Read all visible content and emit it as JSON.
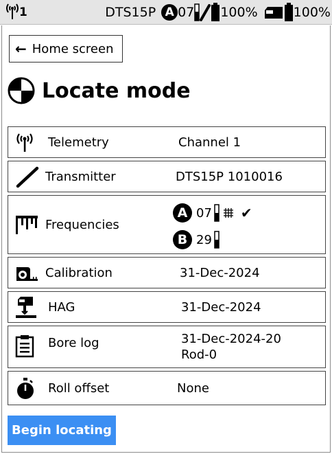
{
  "status_bar": {
    "channel": "1",
    "device_name": "DTS15P",
    "band_letter": "A",
    "band_number": "07",
    "transmitter_battery": "100%",
    "receiver_battery": "100%"
  },
  "home_button": {
    "arrow": "←",
    "label": "Home screen"
  },
  "page_title": "Locate mode",
  "rows": {
    "telemetry": {
      "label": "Telemetry",
      "value": "Channel 1"
    },
    "transmitter": {
      "label": "Transmitter",
      "value": "DTS15P 1010016"
    },
    "frequencies": {
      "label": "Frequencies",
      "a": {
        "letter": "A",
        "number": "07",
        "check": "✔"
      },
      "b": {
        "letter": "B",
        "number": "29"
      }
    },
    "calibration": {
      "label": "Calibration",
      "value": "31-Dec-2024"
    },
    "hag": {
      "label": "HAG",
      "value": "31-Dec-2024"
    },
    "bore_log": {
      "label": "Bore log",
      "value_line1": "31-Dec-2024-20",
      "value_line2": "Rod-0"
    },
    "roll_offset": {
      "label": "Roll offset",
      "value": "None"
    }
  },
  "begin_button": {
    "label": "Begin locating"
  },
  "colors": {
    "accent": "#3b8ff3",
    "status_bar_bg": "#e5e5e5"
  }
}
